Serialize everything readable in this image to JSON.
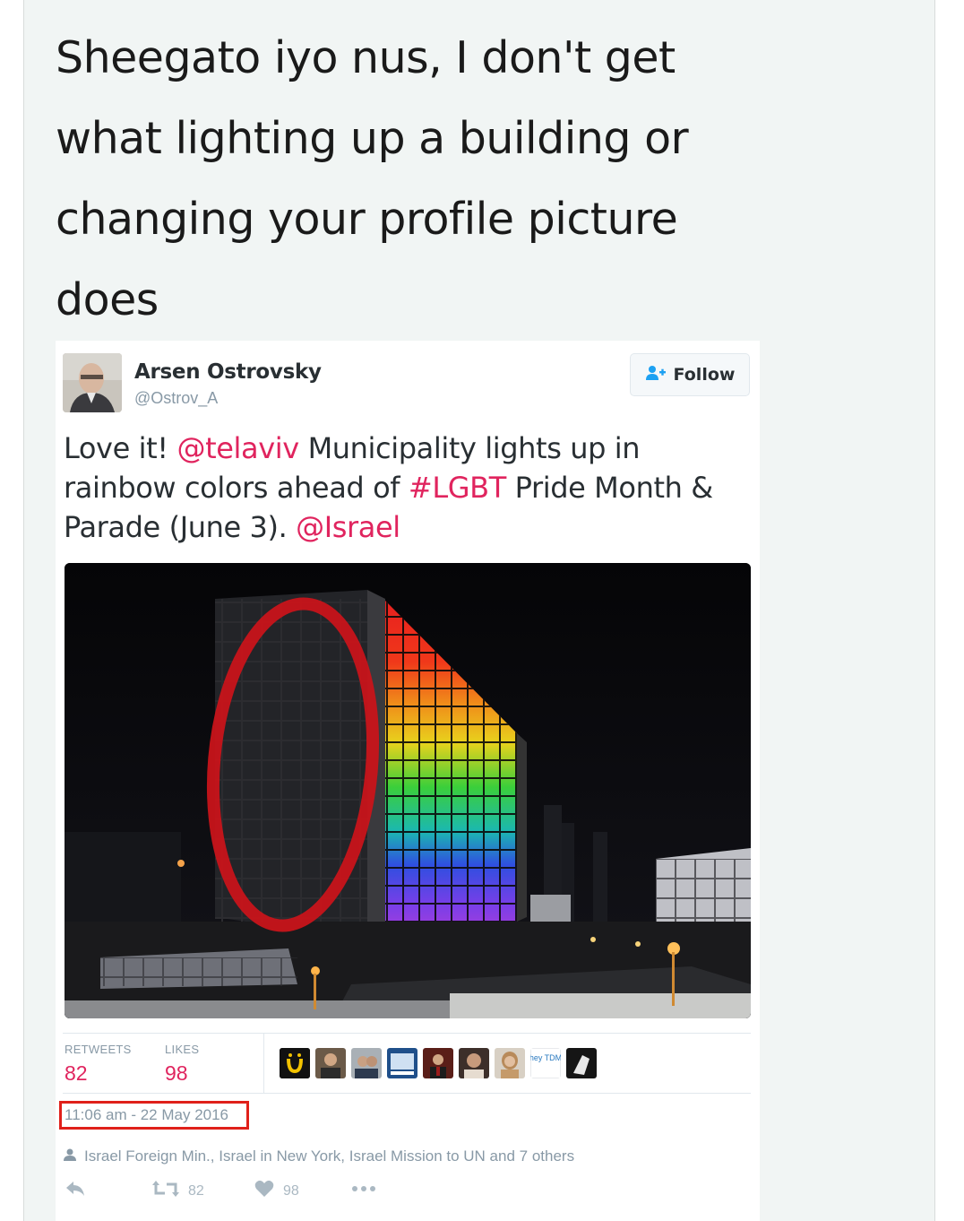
{
  "post": {
    "text": "Sheegato iyo nus, I don't get what lighting up a building or changing your profile picture does"
  },
  "tweet": {
    "author_name": "Arsen Ostrovsky",
    "author_handle": "@Ostrov_A",
    "follow_label": "Follow",
    "text_parts": {
      "p1": "Love it! ",
      "link1": "@telaviv",
      "p2": " Municipality lights up in rainbow colors ahead of ",
      "link2": "#LGBT",
      "p3": " Pride Month & Parade (June 3). ",
      "link3": "@Israel"
    },
    "stats": {
      "retweets_label": "RETWEETS",
      "retweets_value": "82",
      "likes_label": "LIKES",
      "likes_value": "98"
    },
    "timestamp": "11:06 am - 22 May 2016",
    "retweeted_by": "Israel Foreign Min., Israel in New York, Israel Mission to UN and 7 others",
    "actions": {
      "retweet_count": "82",
      "like_count": "98"
    },
    "liker_avatar_badge": "hey TDM"
  },
  "colors": {
    "link": "#e0245e",
    "annotation_red": "#e0201a",
    "muted": "#8899a6"
  }
}
